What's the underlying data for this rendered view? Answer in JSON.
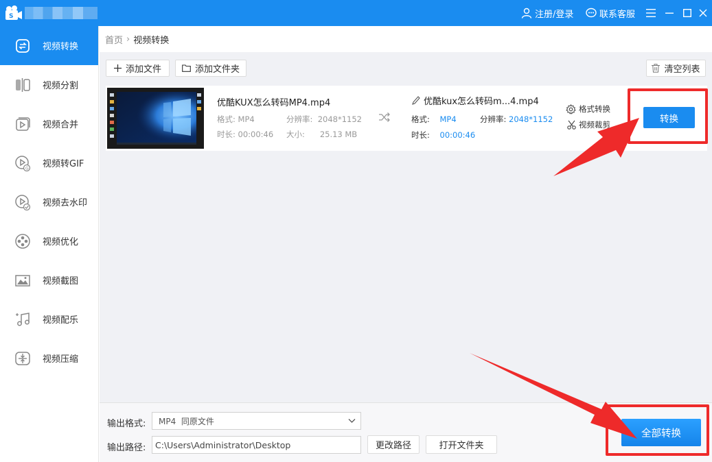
{
  "titlebar": {
    "login_label": "注册/登录",
    "service_label": "联系客服"
  },
  "sidebar": {
    "items": [
      {
        "label": "视频转换",
        "icon": "video-convert-icon"
      },
      {
        "label": "视频分割",
        "icon": "split-icon"
      },
      {
        "label": "视频合并",
        "icon": "merge-icon"
      },
      {
        "label": "视频转GIF",
        "icon": "gif-icon"
      },
      {
        "label": "视频去水印",
        "icon": "watermark-icon"
      },
      {
        "label": "视频优化",
        "icon": "film-reel-icon"
      },
      {
        "label": "视频截图",
        "icon": "screenshot-icon"
      },
      {
        "label": "视频配乐",
        "icon": "music-icon"
      },
      {
        "label": "视频压缩",
        "icon": "compress-icon"
      }
    ]
  },
  "breadcrumb": {
    "home": "首页",
    "current": "视频转换"
  },
  "toolbar": {
    "add_file": "添加文件",
    "add_folder": "添加文件夹",
    "clear_list": "清空列表"
  },
  "file": {
    "source_name": "优酷KUX怎么转码MP4.mp4",
    "format_label": "格式:",
    "format": "MP4",
    "resolution_label": "分辨率:",
    "resolution": "2048*1152",
    "duration_label": "时长:",
    "duration": "00:00:46",
    "size_label": "大小:",
    "size": "25.13 MB",
    "output_name": "优酷kux怎么转码m...4.mp4",
    "out_format": "MP4",
    "out_resolution": "2048*1152",
    "out_duration": "00:00:46",
    "format_convert_label": "格式转换",
    "video_crop_label": "视频裁剪",
    "convert_button": "转换"
  },
  "bottom": {
    "output_format_label": "输出格式:",
    "output_format_value": "MP4  同原文件",
    "output_path_label": "输出路径:",
    "output_path_value": "C:\\Users\\Administrator\\Desktop",
    "change_path": "更改路径",
    "open_folder": "打开文件夹",
    "convert_all": "全部转换"
  },
  "colors": {
    "accent": "#1a8cf0",
    "highlight": "#ee2a2a"
  }
}
